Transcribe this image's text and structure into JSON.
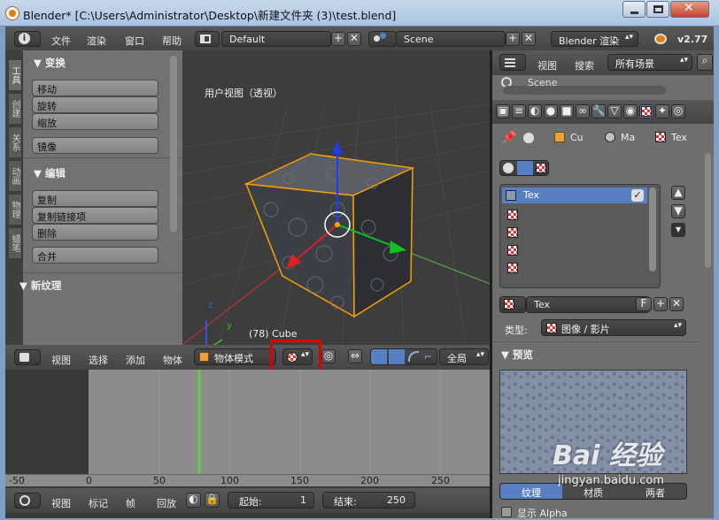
{
  "window": {
    "title": "Blender* [C:\\Users\\Administrator\\Desktop\\新建文件夹 (3)\\test.blend]"
  },
  "info_header": {
    "menus": [
      "文件",
      "渲染",
      "窗口",
      "帮助"
    ],
    "layout": "Default",
    "scene": "Scene",
    "engine": "Blender 渲染",
    "version": "v2.77"
  },
  "toolshelf": {
    "tabs": [
      "工具",
      "创建",
      "关系",
      "动画",
      "物理",
      "蜡笔"
    ],
    "transform_title": "▼ 变换",
    "transform_buttons": [
      "移动",
      "旋转",
      "缩放"
    ],
    "mirror": "镜像",
    "edit_title": "▼ 编辑",
    "edit_buttons": [
      "复制",
      "复制链接项",
      "删除"
    ],
    "join": "合并",
    "new_texture": "▼ 新纹理"
  },
  "viewport": {
    "label": "用户视图（透视）",
    "object_info": "(78) Cube",
    "axis_z": "z",
    "axis_y": "y"
  },
  "view3d_header": {
    "menus": [
      "视图",
      "选择",
      "添加",
      "物体"
    ],
    "mode": "物体模式",
    "pivot": "全局"
  },
  "timeline": {
    "ticks": [
      "-50",
      "0",
      "50",
      "100",
      "150",
      "200",
      "250"
    ],
    "current_frame": 78
  },
  "timeline_header": {
    "menus": [
      "视图",
      "标记",
      "帧",
      "回放"
    ],
    "start_label": "起始:",
    "start_value": "1",
    "end_label": "结束:",
    "end_value": "250"
  },
  "outliner": {
    "menus": [
      "视图",
      "搜索"
    ],
    "filter": "所有场景",
    "scene_item": "Scene"
  },
  "properties": {
    "breadcrumbs": [
      "Cu",
      "Ma",
      "Tex"
    ],
    "slot_name": "Tex",
    "texture_name": "Tex",
    "fake_user": "F",
    "type_label": "类型:",
    "type_value": "图像 / 影片",
    "preview_title": "▼ 预览",
    "bottom_tabs": [
      "纹理",
      "材质",
      "两者"
    ],
    "show_alpha": "显示 Alpha"
  },
  "watermark": {
    "logo": "Bai 经验",
    "url": "jingyan.baidu.com"
  },
  "colors": {
    "accent_blue": "#5680c2",
    "selection_orange": "#f8a000",
    "frame_green": "#60d040",
    "highlight_red": "#e00000"
  }
}
